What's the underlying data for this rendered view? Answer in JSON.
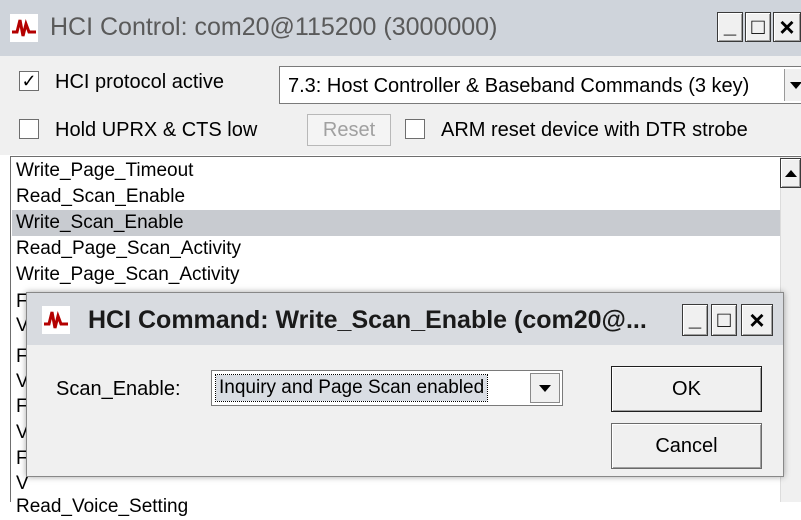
{
  "main_window": {
    "title": "HCI Control: com20@115200 (3000000)",
    "icon": "waveform-icon",
    "controls": {
      "minimize": "_",
      "maximize": "□",
      "close": "×"
    }
  },
  "options": {
    "protocol_active": {
      "label": "HCI protocol active",
      "checked": true,
      "check_mark": "✓"
    },
    "command_group": {
      "selected": "7.3: Host Controller & Baseband Commands (3 key)"
    },
    "hold_uprx": {
      "label": "Hold UPRX & CTS low",
      "checked": false
    },
    "reset_button": "Reset",
    "arm_reset": {
      "label": "ARM reset device with DTR strobe",
      "checked": false
    }
  },
  "command_list": {
    "items": [
      "Write_Page_Timeout",
      "Read_Scan_Enable",
      "Write_Scan_Enable",
      "Read_Page_Scan_Activity",
      "Write_Page_Scan_Activity"
    ],
    "selected_index": 2,
    "partial_letters": [
      "F",
      "V",
      "F",
      "V",
      "F",
      "V",
      "F",
      "V"
    ],
    "partial_bottom": "Read_Voice_Setting"
  },
  "dialog": {
    "title": "HCI Command: Write_Scan_Enable (com20@...",
    "field_label": "Scan_Enable:",
    "field_value": "Inquiry and Page Scan enabled",
    "ok": "OK",
    "cancel": "Cancel",
    "controls": {
      "minimize": "_",
      "maximize": "□",
      "close": "×"
    }
  },
  "colors": {
    "title_bar": "#cfd4db",
    "dialog_bar": "#d8dbe0",
    "selection": "#c8cbd0",
    "accent": "#b40000"
  }
}
